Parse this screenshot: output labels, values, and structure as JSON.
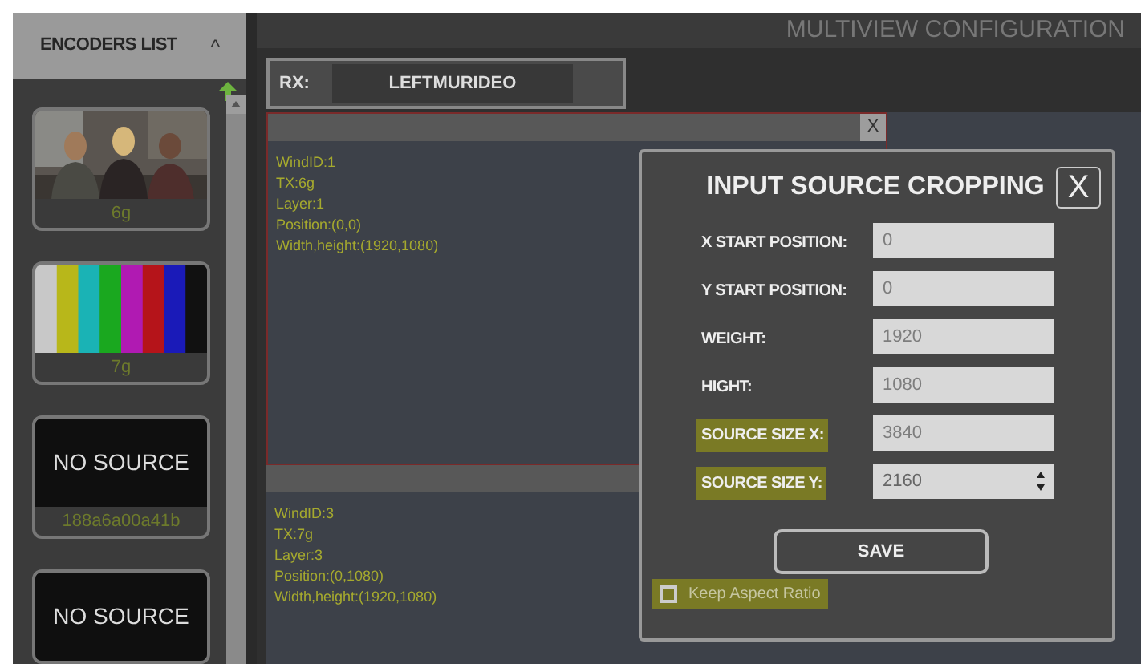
{
  "sidebar": {
    "title": "ENCODERS LIST",
    "collapse_icon": "^",
    "encoders": [
      {
        "kind": "picture",
        "label": "6g"
      },
      {
        "kind": "color-bars",
        "label": "7g"
      },
      {
        "kind": "no-source",
        "text": "NO SOURCE",
        "label": "188a6a00a41b"
      },
      {
        "kind": "no-source",
        "text": "NO SOURCE"
      }
    ]
  },
  "header": {
    "title": "MULTIVIEW CONFIGURATION"
  },
  "rx": {
    "label": "RX:",
    "value": "LEFTMURIDEO"
  },
  "windows": [
    {
      "close": "X",
      "lines": [
        "WindID:1",
        "TX:6g",
        "Layer:1",
        "Position:(0,0)",
        "Width,height:(1920,1080)"
      ]
    },
    {
      "lines": [
        "WindID:3",
        "TX:7g",
        "Layer:3",
        "Position:(0,1080)",
        "Width,height:(1920,1080)"
      ]
    }
  ],
  "dialog": {
    "title": "INPUT SOURCE CROPPING",
    "close": "X",
    "fields": [
      {
        "label": "X START POSITION:",
        "value": "0",
        "highlighted": false,
        "kind": "text"
      },
      {
        "label": "Y START POSITION:",
        "value": "0",
        "highlighted": false,
        "kind": "text"
      },
      {
        "label": "WEIGHT:",
        "value": "1920",
        "highlighted": false,
        "kind": "text"
      },
      {
        "label": "HIGHT:",
        "value": "1080",
        "highlighted": false,
        "kind": "text"
      },
      {
        "label": "SOURCE SIZE X:",
        "value": "3840",
        "highlighted": true,
        "kind": "text"
      },
      {
        "label": "SOURCE SIZE Y:",
        "value": "2160",
        "highlighted": true,
        "kind": "spinner"
      }
    ],
    "save": "SAVE",
    "keep_aspect": {
      "label": "Keep Aspect Ratio",
      "checked": false,
      "highlighted": true
    }
  }
}
